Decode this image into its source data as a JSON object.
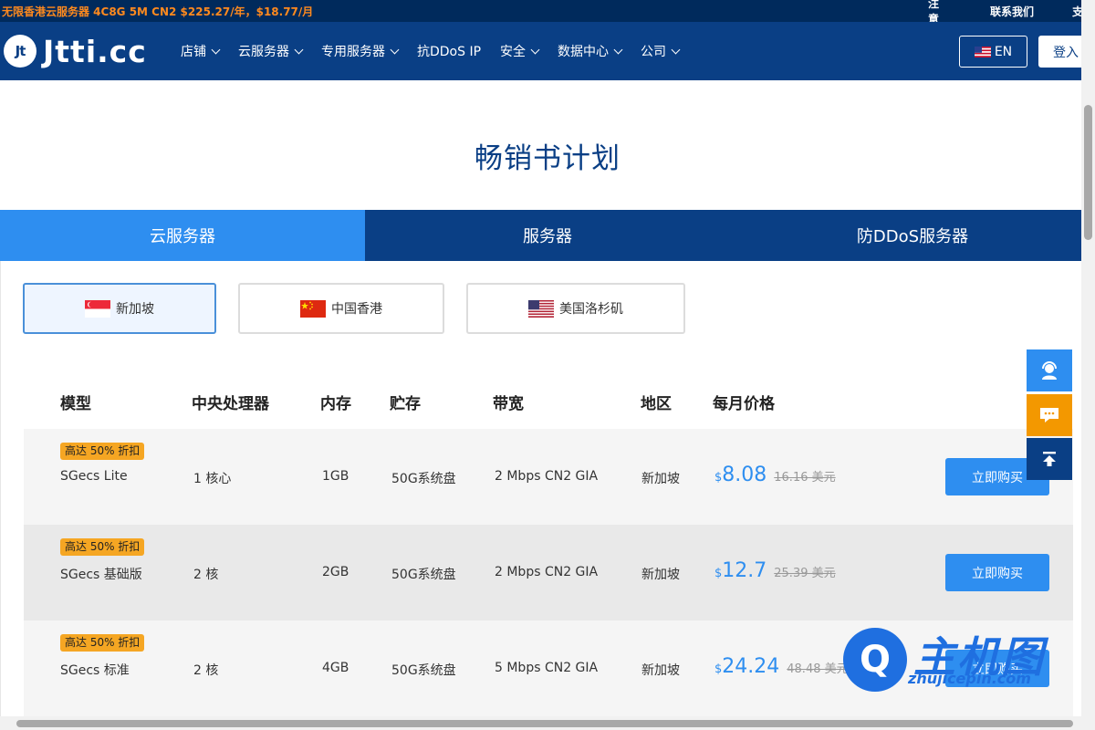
{
  "topbar": {
    "promo": "无限香港云服务器 4C8G 5M CN2 $225.27/年，$18.77/月",
    "links": [
      "注意",
      "联系我们",
      "支"
    ]
  },
  "nav": {
    "logo_mark": "Jt",
    "logo_text": "Jtti.cc",
    "menu": [
      {
        "label": "店铺",
        "dropdown": true
      },
      {
        "label": "云服务器",
        "dropdown": true
      },
      {
        "label": "专用服务器",
        "dropdown": true
      },
      {
        "label": "抗DDoS IP",
        "dropdown": false
      },
      {
        "label": "安全",
        "dropdown": true
      },
      {
        "label": "数据中心",
        "dropdown": true
      },
      {
        "label": "公司",
        "dropdown": true
      }
    ],
    "lang": "EN",
    "login": "登入"
  },
  "page_title": "畅销书计划",
  "category_tabs": [
    {
      "label": "云服务器",
      "active": true
    },
    {
      "label": "服务器",
      "active": false
    },
    {
      "label": "防DDoS服务器",
      "active": false
    }
  ],
  "regions": [
    {
      "label": "新加坡",
      "flag": "sg-flag-icon",
      "active": true
    },
    {
      "label": "中国香港",
      "flag": "cn-flag-icon",
      "active": false
    },
    {
      "label": "美国洛杉矶",
      "flag": "us-flag-icon",
      "active": false
    }
  ],
  "table": {
    "headers": [
      "模型",
      "中央处理器",
      "内存",
      "贮存",
      "带宽",
      "地区",
      "每月价格"
    ],
    "rows": [
      {
        "badge": "高达 50% 折扣",
        "model": "SGecs Lite",
        "cpu": "1 核心",
        "ram": "1GB",
        "storage": "50G系统盘",
        "bandwidth": "2 Mbps CN2 GIA",
        "region": "新加坡",
        "currency": "$",
        "price": "8.08",
        "old_price": "16.16 美元",
        "buy": "立即购买"
      },
      {
        "badge": "高达 50% 折扣",
        "model": "SGecs 基础版",
        "cpu": "2 核",
        "ram": "2GB",
        "storage": "50G系统盘",
        "bandwidth": "2 Mbps CN2 GIA",
        "region": "新加坡",
        "currency": "$",
        "price": "12.7",
        "old_price": "25.39 美元",
        "buy": "立即购买"
      },
      {
        "badge": "高达 50% 折扣",
        "model": "SGecs 标准",
        "cpu": "2 核",
        "ram": "4GB",
        "storage": "50G系统盘",
        "bandwidth": "5 Mbps CN2 GIA",
        "region": "新加坡",
        "currency": "$",
        "price": "24.24",
        "old_price": "48.48 美元",
        "buy": "立即购买"
      }
    ]
  },
  "side_tools": [
    "support-agent-icon",
    "chat-icon",
    "back-to-top-icon"
  ],
  "watermark": {
    "mark": "Q",
    "cn": "主机图",
    "en": "zhujicepin.com"
  },
  "colors": {
    "nav": "#0a3f85",
    "topbar": "#002a5c",
    "accent": "#2e8ef0",
    "promo": "#ff8a1e",
    "badge": "#f5a623",
    "side_orange": "#f39800"
  }
}
